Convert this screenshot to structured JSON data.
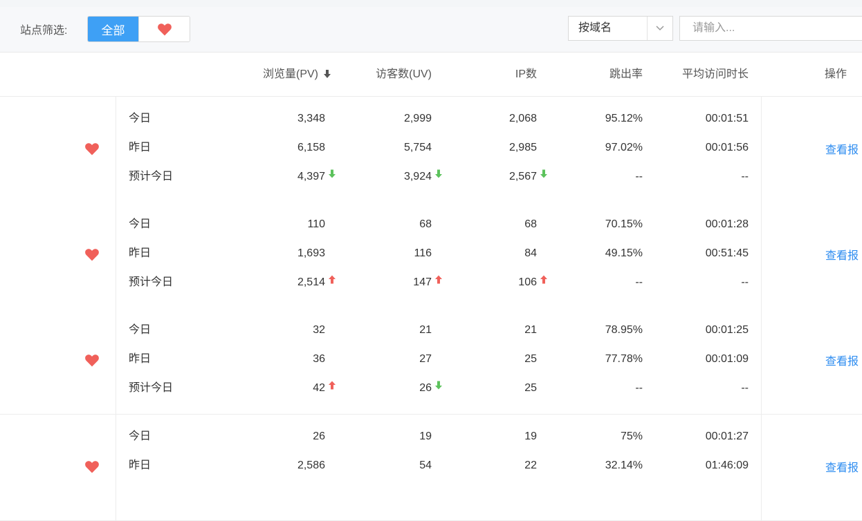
{
  "filter": {
    "label": "站点筛选:",
    "all_label": "全部"
  },
  "search": {
    "select_value": "按域名",
    "placeholder": "请输入..."
  },
  "columns": {
    "pv": "浏览量(PV)",
    "uv": "访客数(UV)",
    "ip": "IP数",
    "bounce": "跳出率",
    "duration": "平均访问时长",
    "action": "操作"
  },
  "colors": {
    "accent": "#3ea0f5",
    "heart": "#f0605a",
    "up": "#f0605a",
    "down": "#5cc25c",
    "link": "#2d8cf0"
  },
  "rows": [
    {
      "today": {
        "label": "今日",
        "pv": "3,348",
        "uv": "2,999",
        "ip": "2,068",
        "bounce": "95.12%",
        "duration": "00:01:51"
      },
      "yesterday": {
        "label": "昨日",
        "pv": "6,158",
        "uv": "5,754",
        "ip": "2,985",
        "bounce": "97.02%",
        "duration": "00:01:56"
      },
      "forecast": {
        "label": "预计今日",
        "pv": "4,397",
        "pv_trend": "down",
        "uv": "3,924",
        "uv_trend": "down",
        "ip": "2,567",
        "ip_trend": "down",
        "bounce": "--",
        "duration": "--"
      },
      "action": "查看报"
    },
    {
      "today": {
        "label": "今日",
        "pv": "110",
        "uv": "68",
        "ip": "68",
        "bounce": "70.15%",
        "duration": "00:01:28"
      },
      "yesterday": {
        "label": "昨日",
        "pv": "1,693",
        "uv": "116",
        "ip": "84",
        "bounce": "49.15%",
        "duration": "00:51:45"
      },
      "forecast": {
        "label": "预计今日",
        "pv": "2,514",
        "pv_trend": "up",
        "uv": "147",
        "uv_trend": "up",
        "ip": "106",
        "ip_trend": "up",
        "bounce": "--",
        "duration": "--"
      },
      "action": "查看报"
    },
    {
      "today": {
        "label": "今日",
        "pv": "32",
        "uv": "21",
        "ip": "21",
        "bounce": "78.95%",
        "duration": "00:01:25"
      },
      "yesterday": {
        "label": "昨日",
        "pv": "36",
        "uv": "27",
        "ip": "25",
        "bounce": "77.78%",
        "duration": "00:01:09"
      },
      "forecast": {
        "label": "预计今日",
        "pv": "42",
        "pv_trend": "up",
        "uv": "26",
        "uv_trend": "down",
        "ip": "25",
        "ip_trend": "none",
        "bounce": "--",
        "duration": "--"
      },
      "action": "查看报"
    },
    {
      "today": {
        "label": "今日",
        "pv": "26",
        "uv": "19",
        "ip": "19",
        "bounce": "75%",
        "duration": "00:01:27"
      },
      "yesterday": {
        "label": "昨日",
        "pv": "2,586",
        "uv": "54",
        "ip": "22",
        "bounce": "32.14%",
        "duration": "01:46:09"
      },
      "action": "查看报"
    }
  ]
}
